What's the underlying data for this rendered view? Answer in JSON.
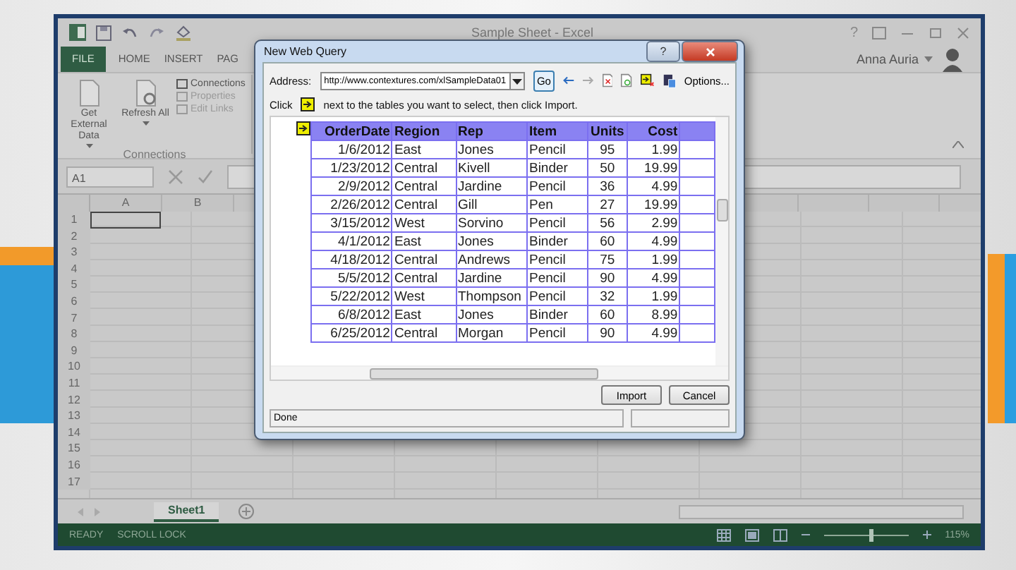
{
  "excel": {
    "title": "Sample Sheet - Excel",
    "help": "?",
    "user": "Anna Auria",
    "tabs": [
      {
        "label": "FILE",
        "kind": "file"
      },
      {
        "label": "HOME",
        "kind": "tab"
      },
      {
        "label": "INSERT",
        "kind": "tab"
      },
      {
        "label": "PAG",
        "kind": "tab"
      }
    ],
    "ribbon": {
      "big_buttons": [
        "Get External Data",
        "Refresh All"
      ],
      "small_buttons": [
        {
          "label": "Connections",
          "disabled": false
        },
        {
          "label": "Properties",
          "disabled": true
        },
        {
          "label": "Edit Links",
          "disabled": true
        }
      ],
      "group_label": "Connections"
    },
    "name_box": "A1",
    "columns": [
      "A",
      "B"
    ],
    "rows": [
      "1",
      "2",
      "3",
      "4",
      "5",
      "6",
      "7",
      "8",
      "9",
      "10",
      "11",
      "12",
      "13",
      "14",
      "15",
      "16",
      "17"
    ],
    "sheet_tabs": [
      {
        "label": "Sheet1",
        "selected": true
      }
    ],
    "status": [
      "READY",
      "SCROLL LOCK"
    ],
    "zoom": {
      "level": 0.55,
      "reading": "115%"
    }
  },
  "dialog": {
    "title": "New Web Query",
    "help": "?",
    "address_label": "Address:",
    "address": "http://www.contextures.com/xlSampleData01",
    "go": "Go",
    "options": "Options...",
    "hint_prefix": "Click",
    "hint": "next to the tables you want to select, then click Import.",
    "table": {
      "columns": [
        "OrderDate",
        "Region",
        "Rep",
        "Item",
        "Units",
        "Cost"
      ],
      "rows": [
        [
          "1/6/2012",
          "East",
          "Jones",
          "Pencil",
          "95",
          "1.99"
        ],
        [
          "1/23/2012",
          "Central",
          "Kivell",
          "Binder",
          "50",
          "19.99"
        ],
        [
          "2/9/2012",
          "Central",
          "Jardine",
          "Pencil",
          "36",
          "4.99"
        ],
        [
          "2/26/2012",
          "Central",
          "Gill",
          "Pen",
          "27",
          "19.99"
        ],
        [
          "3/15/2012",
          "West",
          "Sorvino",
          "Pencil",
          "56",
          "2.99"
        ],
        [
          "4/1/2012",
          "East",
          "Jones",
          "Binder",
          "60",
          "4.99"
        ],
        [
          "4/18/2012",
          "Central",
          "Andrews",
          "Pencil",
          "75",
          "1.99"
        ],
        [
          "5/5/2012",
          "Central",
          "Jardine",
          "Pencil",
          "90",
          "4.99"
        ],
        [
          "5/22/2012",
          "West",
          "Thompson",
          "Pencil",
          "32",
          "1.99"
        ],
        [
          "6/8/2012",
          "East",
          "Jones",
          "Binder",
          "60",
          "8.99"
        ],
        [
          "6/25/2012",
          "Central",
          "Morgan",
          "Pencil",
          "90",
          "4.99"
        ]
      ]
    },
    "buttons": [
      "Import",
      "Cancel"
    ],
    "status": "Done"
  }
}
